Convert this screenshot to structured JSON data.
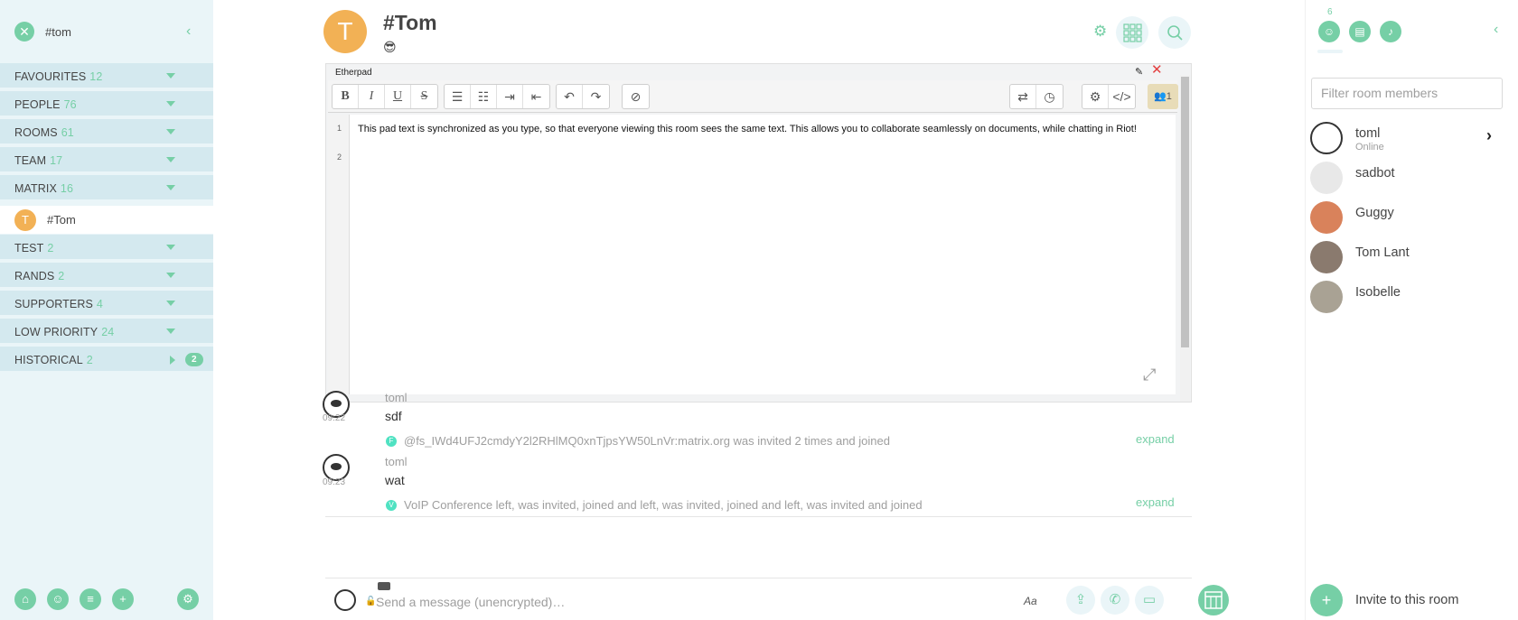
{
  "left_panel": {
    "filter_text": "#tom",
    "sections": [
      {
        "label": "FAVOURITES",
        "count": "12"
      },
      {
        "label": "PEOPLE",
        "count": "76"
      },
      {
        "label": "ROOMS",
        "count": "61"
      },
      {
        "label": "TEAM",
        "count": "17"
      },
      {
        "label": "MATRIX",
        "count": "16"
      },
      {
        "label": "TEST",
        "count": "2"
      },
      {
        "label": "RANDS",
        "count": "2"
      },
      {
        "label": "SUPPORTERS",
        "count": "4"
      },
      {
        "label": "LOW PRIORITY",
        "count": "24"
      },
      {
        "label": "HISTORICAL",
        "count": "2",
        "badge": "2"
      }
    ],
    "active_room": {
      "avatar_letter": "T",
      "name": "#Tom"
    }
  },
  "header": {
    "avatar_letter": "T",
    "room_name": "#Tom",
    "topic": "😎"
  },
  "widget": {
    "title": "Etherpad",
    "line_numbers": [
      "1",
      "2"
    ],
    "pad_text": "This pad text is synchronized as you type, so that everyone viewing this room sees the same text. This allows you to collaborate seamlessly on documents, while chatting in Riot!",
    "users_count": "1"
  },
  "timeline": {
    "messages": [
      {
        "sender": "toml",
        "time": "09:22",
        "body": "sdf"
      },
      {
        "sender": "toml",
        "time": "09:23",
        "body": "wat"
      }
    ],
    "events": [
      {
        "avatar_letter": "F",
        "text": "@fs_IWd4UFJ2cmdyY2l2RHlMQ0xnTjpsYW50LnVr:matrix.org was invited 2 times and joined",
        "expand": "expand"
      },
      {
        "avatar_letter": "V",
        "text": "VoIP Conference left, was invited, joined and left, was invited, joined and left, was invited and joined",
        "expand": "expand"
      }
    ]
  },
  "composer": {
    "placeholder": "Send a message (unencrypted)…"
  },
  "right_panel": {
    "member_count": "6",
    "filter_placeholder": "Filter room members",
    "members": [
      {
        "name": "toml",
        "status": "Online"
      },
      {
        "name": "sadbot",
        "status": ""
      },
      {
        "name": "Guggy",
        "status": ""
      },
      {
        "name": "Tom Lant",
        "status": ""
      },
      {
        "name": "Isobelle",
        "status": ""
      }
    ],
    "invite_label": "Invite to this room"
  },
  "colors": {
    "accent": "#76cfa6",
    "panel_bg": "#eaf5f8",
    "section_bg": "#d4e9ef",
    "room_avatar": "#f2b155"
  }
}
